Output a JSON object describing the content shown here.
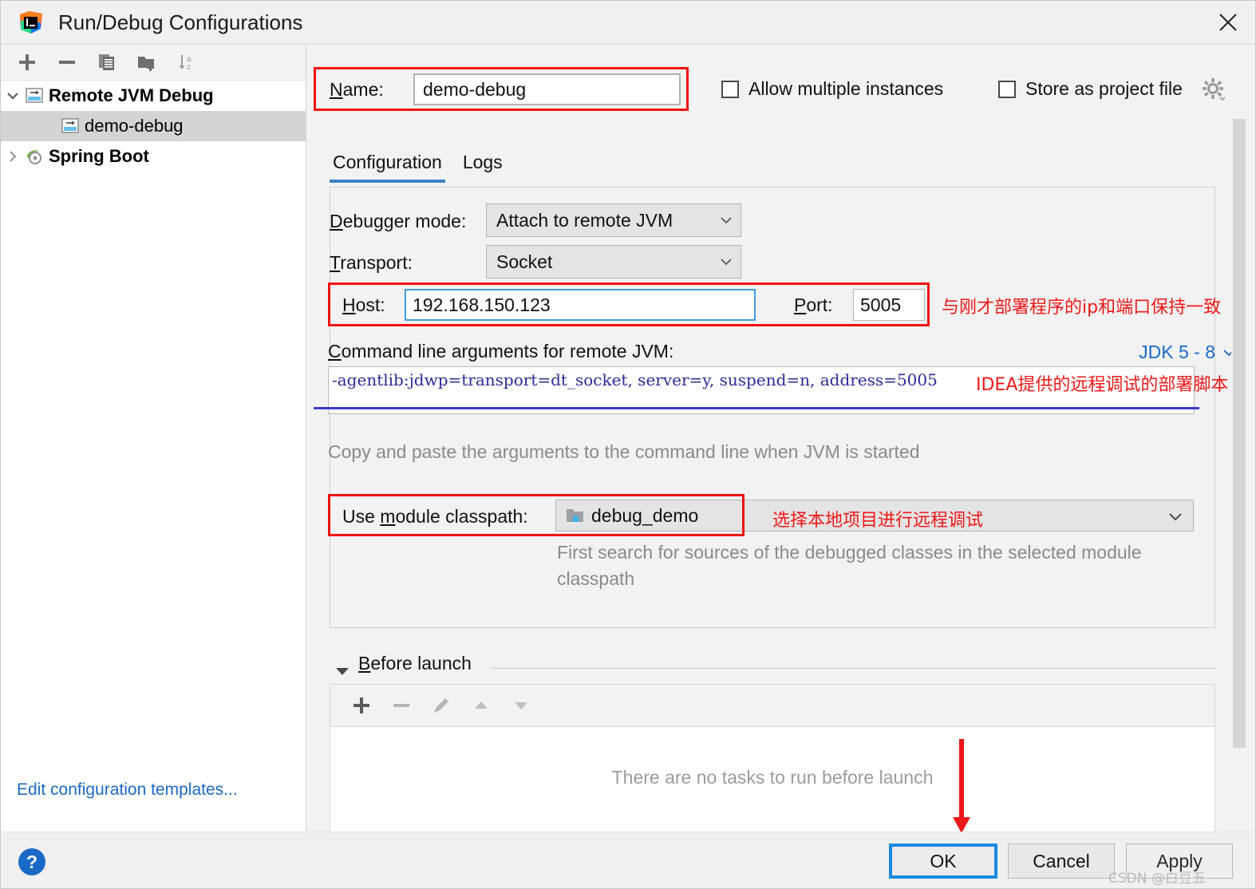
{
  "window": {
    "title": "Run/Debug Configurations",
    "app_icon": "intellij-idea-icon",
    "close_icon": "close-icon"
  },
  "sidebar": {
    "toolbar": [
      {
        "name": "add-configuration-button",
        "icon": "plus-icon",
        "label": "+"
      },
      {
        "name": "remove-configuration-button",
        "icon": "minus-icon",
        "label": "−"
      },
      {
        "name": "copy-configuration-button",
        "icon": "copy-icon",
        "label": "Copy"
      },
      {
        "name": "save-configuration-button",
        "icon": "folder-add-icon",
        "label": "Save"
      },
      {
        "name": "sort-configurations-button",
        "icon": "sort-alphabetically-icon",
        "label": "Sort"
      }
    ],
    "tree": [
      {
        "label": "Remote JVM Debug",
        "icon": "remote-debug-icon",
        "expanded": true,
        "bold": true,
        "selected": false,
        "child": false
      },
      {
        "label": "demo-debug",
        "icon": "remote-debug-icon",
        "expanded": null,
        "bold": false,
        "selected": true,
        "child": true
      },
      {
        "label": "Spring Boot",
        "icon": "spring-boot-icon",
        "expanded": false,
        "bold": true,
        "selected": false,
        "child": false
      }
    ],
    "edit_templates_link": "Edit configuration templates..."
  },
  "form": {
    "name_label": "Name:",
    "name_value": "demo-debug",
    "allow_multiple_instances": {
      "label": "Allow multiple instances",
      "checked": false
    },
    "store_as_project_file": {
      "label": "Store as project file",
      "checked": false
    },
    "gear_icon": "gear-icon"
  },
  "tabs": [
    {
      "label": "Configuration",
      "active": true
    },
    {
      "label": "Logs",
      "active": false
    }
  ],
  "configuration": {
    "debugger_mode_label": "Debugger mode:",
    "debugger_mode_value": "Attach to remote JVM",
    "transport_label": "Transport:",
    "transport_value": "Socket",
    "host_label": "Host:",
    "host_value": "192.168.150.123",
    "port_label": "Port:",
    "port_value": "5005",
    "command_line_label": "Command line arguments for remote JVM:",
    "jdk_selector": "JDK 5 - 8",
    "command_line_value": "-agentlib:jdwp=transport=dt_socket, server=y, suspend=n, address=5005",
    "copy_hint": "Copy and paste the arguments to the command line when JVM is started",
    "module_classpath_label": "Use module classpath:",
    "module_classpath_value": "debug_demo",
    "module_classpath_icon": "module-folder-icon",
    "module_hint": "First search for sources of the debugged classes in the selected module classpath"
  },
  "before_launch": {
    "title": "Before launch",
    "collapse_icon": "triangle-down-icon",
    "toolbar": [
      {
        "name": "add-task-button",
        "icon": "plus-icon"
      },
      {
        "name": "remove-task-button",
        "icon": "minus-icon"
      },
      {
        "name": "edit-task-button",
        "icon": "pencil-icon"
      },
      {
        "name": "move-task-up-button",
        "icon": "arrow-up-icon"
      },
      {
        "name": "move-task-down-button",
        "icon": "arrow-down-icon"
      }
    ],
    "empty_message": "There are no tasks to run before launch"
  },
  "annotations": [
    {
      "name": "host-port-annotation",
      "text": "与刚才部署程序的ip和端口保持一致"
    },
    {
      "name": "command-line-annotation",
      "text": "IDEA提供的远程调试的部署脚本"
    },
    {
      "name": "module-classpath-annotation",
      "text": "选择本地项目进行远程调试"
    }
  ],
  "footer": {
    "help_label": "?",
    "ok_label": "OK",
    "cancel_label": "Cancel",
    "apply_label": "Apply"
  },
  "watermark": "CSDN @白豆五",
  "colors": {
    "accent_blue": "#1a69c6",
    "annotation_red": "#f01818",
    "highlight_box_red": "#f50d0d",
    "tab_underline": "#3b82c4",
    "args_text": "#2b2b9b"
  }
}
